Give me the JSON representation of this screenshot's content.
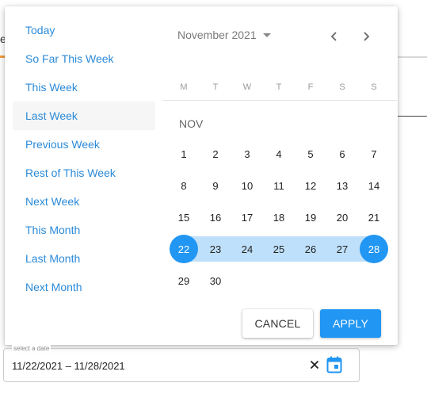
{
  "background": {
    "partial_text": "e"
  },
  "presets": [
    {
      "label": "Today"
    },
    {
      "label": "So Far This Week"
    },
    {
      "label": "This Week"
    },
    {
      "label": "Last Week",
      "active": true
    },
    {
      "label": "Previous Week"
    },
    {
      "label": "Rest of This Week"
    },
    {
      "label": "Next Week"
    },
    {
      "label": "This Month"
    },
    {
      "label": "Last Month"
    },
    {
      "label": "Next Month"
    }
  ],
  "calendar": {
    "month_year": "November 2021",
    "month_short": "NOV",
    "weekdays": [
      "M",
      "T",
      "W",
      "T",
      "F",
      "S",
      "S"
    ],
    "weeks": [
      [
        "1",
        "2",
        "3",
        "4",
        "5",
        "6",
        "7"
      ],
      [
        "8",
        "9",
        "10",
        "11",
        "12",
        "13",
        "14"
      ],
      [
        "15",
        "16",
        "17",
        "18",
        "19",
        "20",
        "21"
      ],
      [
        "22",
        "23",
        "24",
        "25",
        "26",
        "27",
        "28"
      ],
      [
        "29",
        "30",
        "",
        "",
        "",
        "",
        ""
      ]
    ],
    "range_start": "22",
    "range_end": "28",
    "prev_icon": "chevron-left-icon",
    "next_icon": "chevron-right-icon"
  },
  "actions": {
    "cancel_label": "CANCEL",
    "apply_label": "APPLY"
  },
  "date_field": {
    "label": "select a date",
    "value": "11/22/2021 – 11/28/2021",
    "clear_icon": "close-icon",
    "calendar_icon": "calendar-icon"
  },
  "colors": {
    "accent": "#2196f3",
    "range": "#bfe0fb",
    "link": "#2b8ad8"
  }
}
